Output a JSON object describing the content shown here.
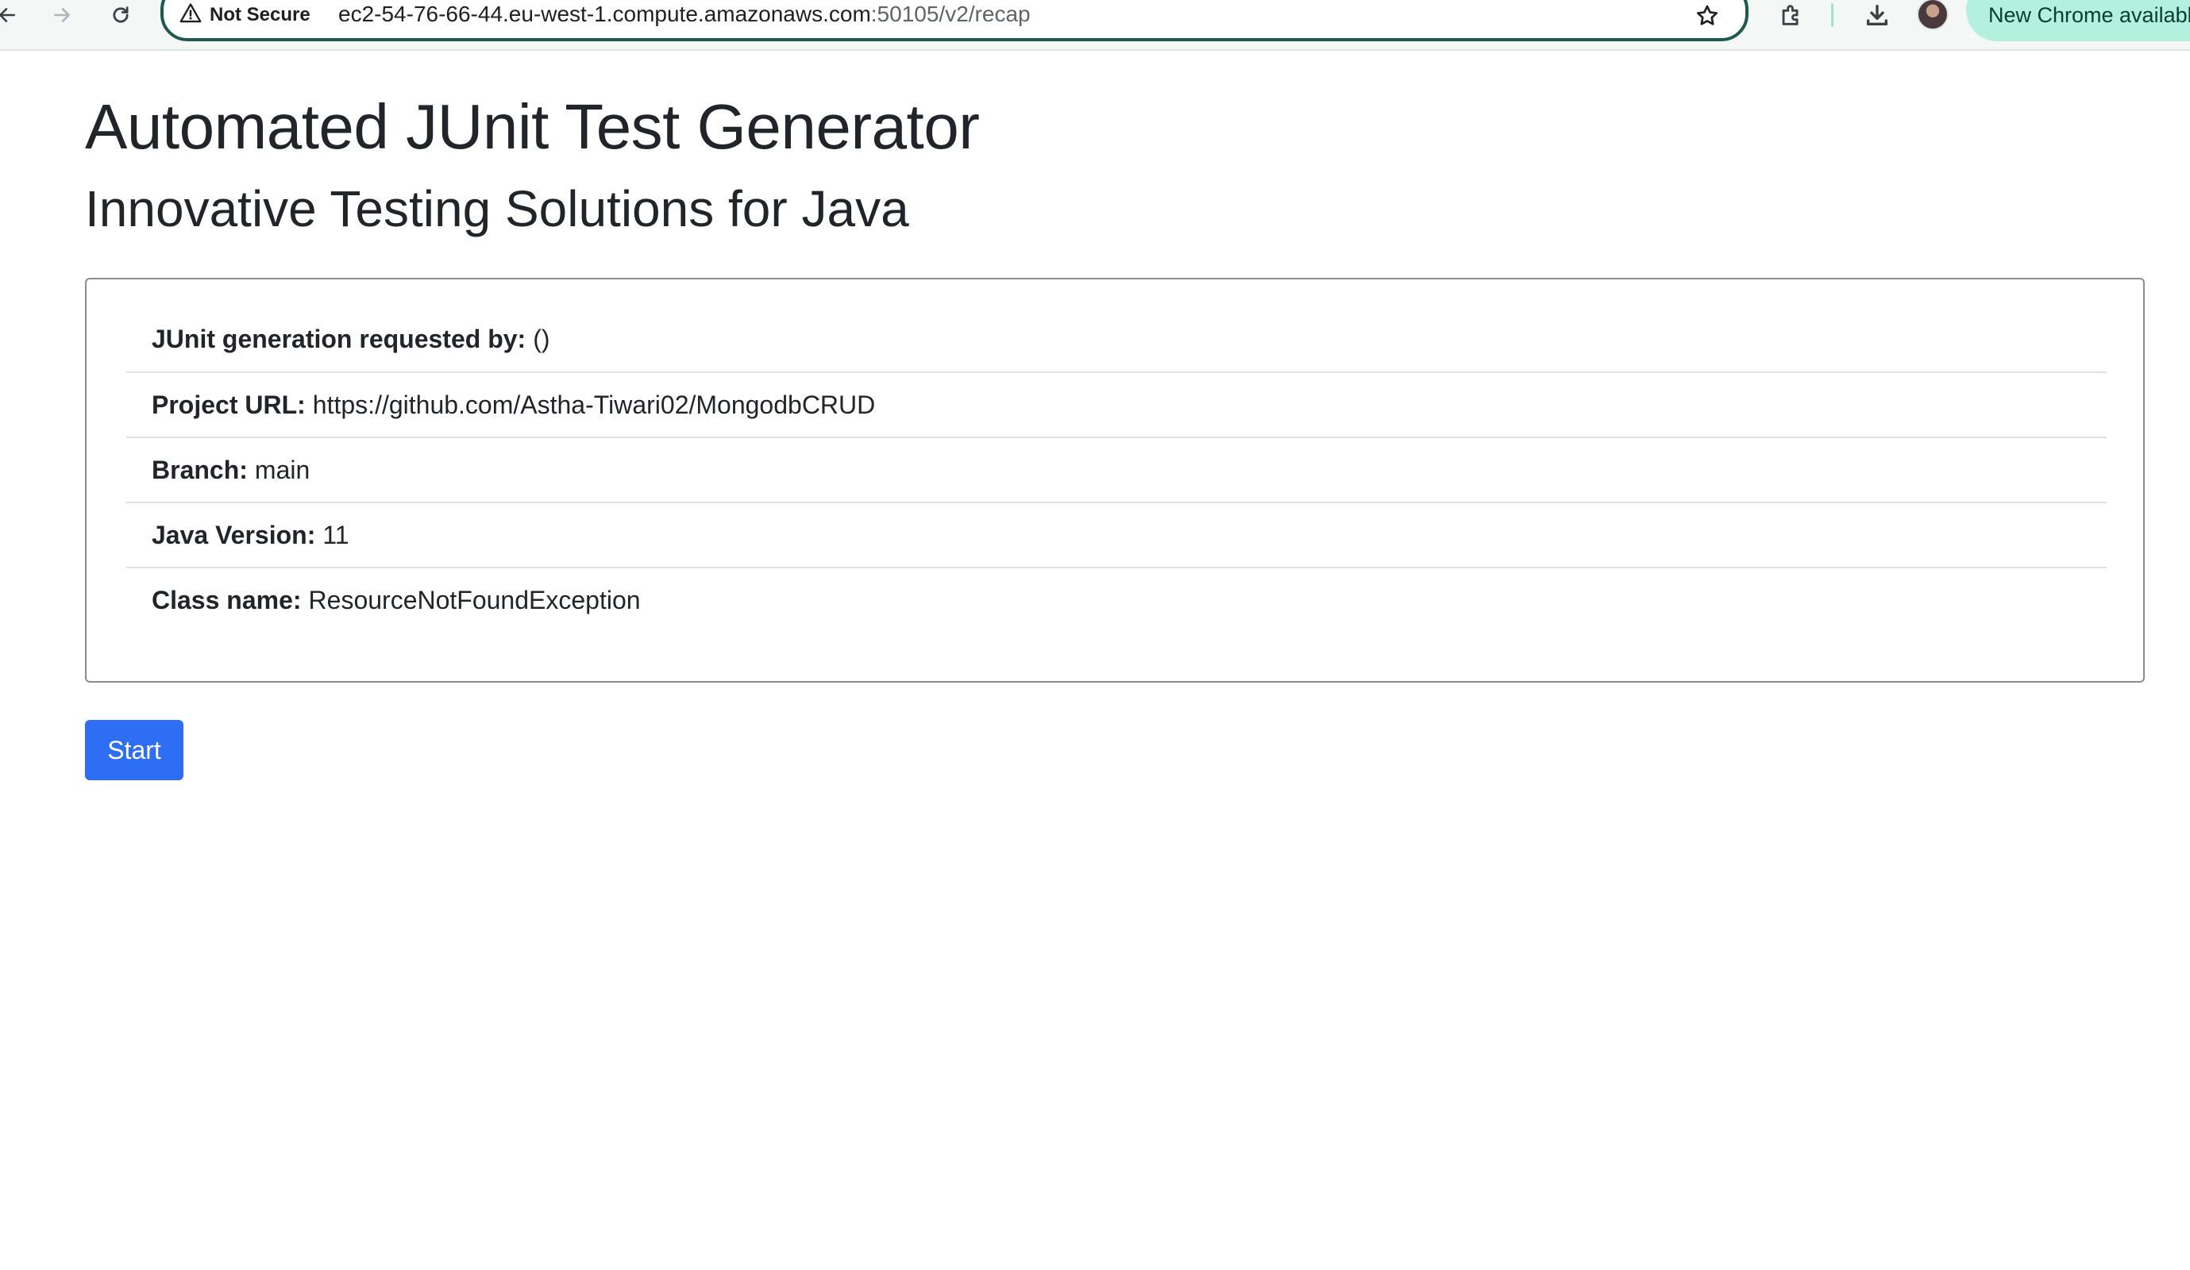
{
  "browser": {
    "security_label": "Not Secure",
    "url_host": "ec2-54-76-66-44.eu-west-1.compute.amazonaws.com",
    "url_path": ":50105/v2/recap",
    "update_chip_label": "New Chrome availabl",
    "icons": [
      "back-icon",
      "forward-icon",
      "reload-icon",
      "warning-icon",
      "star-icon",
      "extensions-icon",
      "download-icon",
      "avatar"
    ]
  },
  "page": {
    "title": "Automated JUnit Test Generator",
    "subtitle": "Innovative Testing Solutions for Java"
  },
  "recap": {
    "items": [
      {
        "label": "JUnit generation requested by:",
        "value": "()"
      },
      {
        "label": "Project URL:",
        "value": "https://github.com/Astha-Tiwari02/MongodbCRUD"
      },
      {
        "label": "Branch:",
        "value": "main"
      },
      {
        "label": "Java Version:",
        "value": "11"
      },
      {
        "label": "Class name:",
        "value": "ResourceNotFoundException"
      }
    ]
  },
  "actions": {
    "start_label": "Start"
  },
  "colors": {
    "primary_button": "#2e6ef4",
    "omnibox_border": "#1d5a4c",
    "update_chip": "#b3f0de"
  }
}
